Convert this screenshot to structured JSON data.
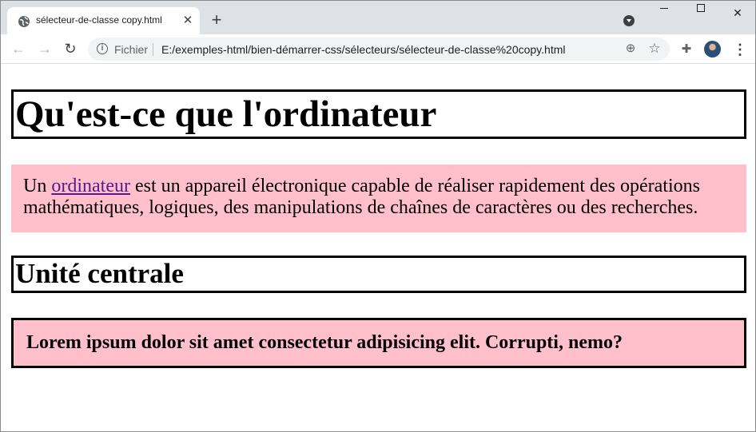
{
  "browser": {
    "tab_title": "sélecteur-de-classe copy.html",
    "tab_close": "✕",
    "new_tab": "+",
    "scheme_label": "Fichier",
    "url": "E:/exemples-html/bien-démarrer-css/sélecteurs/sélecteur-de-classe%20copy.html",
    "window": {
      "close": "✕"
    },
    "icons": {
      "back": "←",
      "forward": "→",
      "reload": "↻",
      "info": "i",
      "zoom": "⊕",
      "star": "☆",
      "extensions": "✚",
      "menu": "⋮"
    }
  },
  "page": {
    "heading1": "Qu'est-ce que l'ordinateur",
    "intro_prefix": "Un ",
    "intro_link": "ordinateur",
    "intro_rest": " est un appareil électronique capable de réaliser rapidement des opérations mathématiques, logiques, des manipulations de chaînes de caractères ou des recherches.",
    "heading2": "Unité centrale",
    "lorem": "Lorem ipsum dolor sit amet consectetur adipisicing elit. Corrupti, nemo?"
  },
  "colors": {
    "pink_background": "#ffc0cb",
    "link": "#551a8b",
    "tabstrip": "#dee1e6"
  }
}
